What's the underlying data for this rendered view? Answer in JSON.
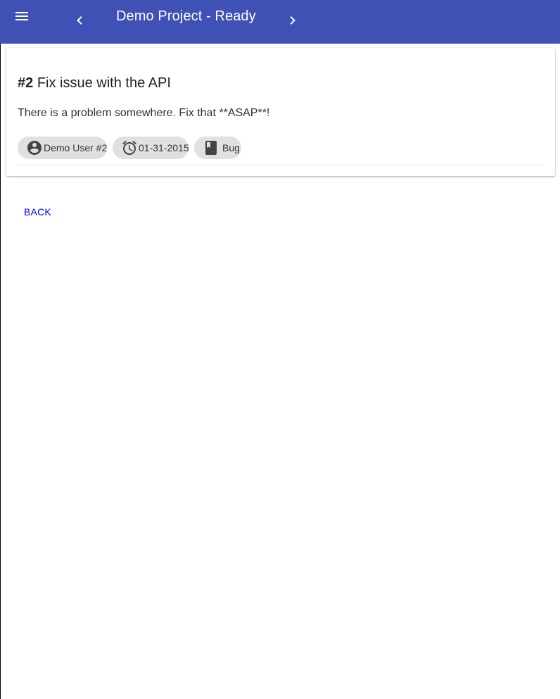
{
  "appbar": {
    "title": "Demo Project - Ready",
    "menu_icon": "menu-icon",
    "prev_icon": "chevron-left-icon",
    "next_icon": "chevron-right-icon",
    "background": "#3f51b5"
  },
  "issue": {
    "number": "#2",
    "title": "Fix issue with the API",
    "description": "There is a problem somewhere. Fix that **ASAP**!",
    "chips": {
      "assignee": {
        "label": "Demo User #2",
        "icon": "account-circle-icon"
      },
      "due_date": {
        "label": "01-31-2015",
        "icon": "alarm-icon"
      },
      "type": {
        "label": "Bug",
        "icon": "bookmark-icon"
      }
    }
  },
  "actions": {
    "back_label": "BACK",
    "back_color": "#0000ee"
  }
}
